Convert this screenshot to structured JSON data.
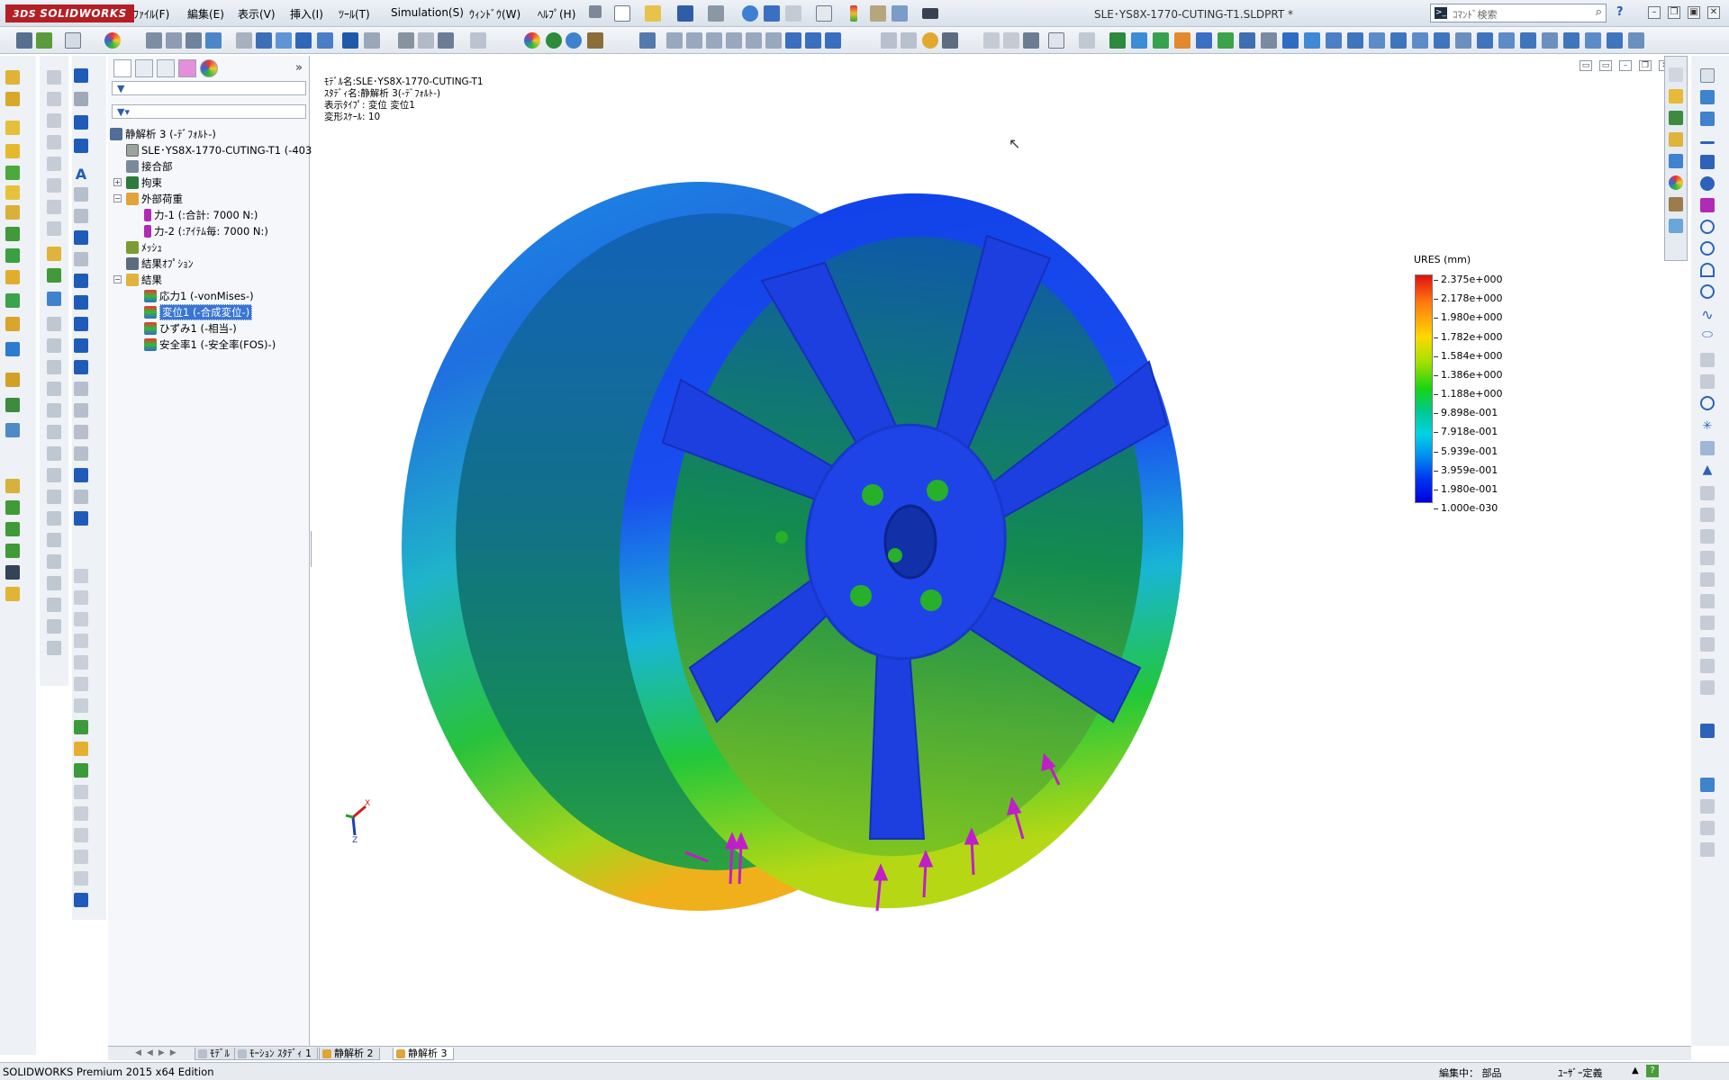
{
  "app": {
    "logo_text": "SOLIDWORKS",
    "window_title": "SLE･YS8X-1770-CUTING-T1.SLDPRT *"
  },
  "menu": [
    "ﾌｧｲﾙ(F)",
    "編集(E)",
    "表示(V)",
    "挿入(I)",
    "ﾂｰﾙ(T)",
    "Simulation(S)",
    "ｳｨﾝﾄﾞｳ(W)",
    "ﾍﾙﾌﾟ(H)"
  ],
  "search": {
    "placeholder": "ｺﾏﾝﾄﾞ検索"
  },
  "tree": {
    "nodes": [
      {
        "label": "静解析 3 (-ﾃﾞﾌｫﾙﾄ-)",
        "icon": "study-icon"
      },
      {
        "label": "SLE･YS8X-1770-CUTING-T1 (-403",
        "icon": "part-icon"
      },
      {
        "label": "接合部",
        "icon": "connections-icon"
      },
      {
        "label": "拘束",
        "icon": "fixtures-icon"
      },
      {
        "label": "外部荷重",
        "icon": "external-loads-icon"
      },
      {
        "label": "力-1 (:合計: 7000 N:)",
        "icon": "force-icon"
      },
      {
        "label": "力-2 (:ｱｲﾃﾑ毎: 7000 N:)",
        "icon": "force-icon"
      },
      {
        "label": "ﾒｯｼｭ",
        "icon": "mesh-icon"
      },
      {
        "label": "結果ｵﾌﾟｼｮﾝ",
        "icon": "result-options-icon"
      },
      {
        "label": "結果",
        "icon": "results-folder-icon"
      },
      {
        "label": "応力1 (-vonMises-)",
        "icon": "stress-plot-icon"
      },
      {
        "label": "変位1 (-合成変位-)",
        "icon": "displacement-plot-icon"
      },
      {
        "label": "ひずみ1 (-相当-)",
        "icon": "strain-plot-icon"
      },
      {
        "label": "安全率1 (-安全率(FOS)-)",
        "icon": "fos-plot-icon"
      }
    ]
  },
  "viewport_info": {
    "model": "ﾓﾃﾞﾙ名:SLE･YS8X-1770-CUTING-T1",
    "study": "ｽﾀﾃﾞｨ名:静解析 3(-ﾃﾞﾌｫﾙﾄ-)",
    "plot_type": "表示ﾀｲﾌﾟ: 変位 変位1",
    "scale": "変形ｽｹｰﾙ: 10"
  },
  "legend": {
    "title": "URES (mm)",
    "labels": [
      "2.375e+000",
      "2.178e+000",
      "1.980e+000",
      "1.782e+000",
      "1.584e+000",
      "1.386e+000",
      "1.188e+000",
      "9.898e-001",
      "7.918e-001",
      "5.939e-001",
      "3.959e-001",
      "1.980e-001",
      "1.000e-030"
    ]
  },
  "triad": {
    "x": "X",
    "z": "Z"
  },
  "bottom_tabs": [
    "ﾓﾃﾞﾙ",
    "ﾓｰｼｮﾝ ｽﾀﾃﾞｨ 1",
    "静解析 2",
    "静解析 3"
  ],
  "status": {
    "edition": "SOLIDWORKS Premium 2015 x64 Edition",
    "mode": "編集中： 部品",
    "units": "ﾕｰｻﾞｰ定義"
  },
  "colors": {
    "brand": "#b41e24",
    "selection": "#3875d6",
    "force_arrow": "#c01ec8",
    "fixture": "#22a81e"
  }
}
